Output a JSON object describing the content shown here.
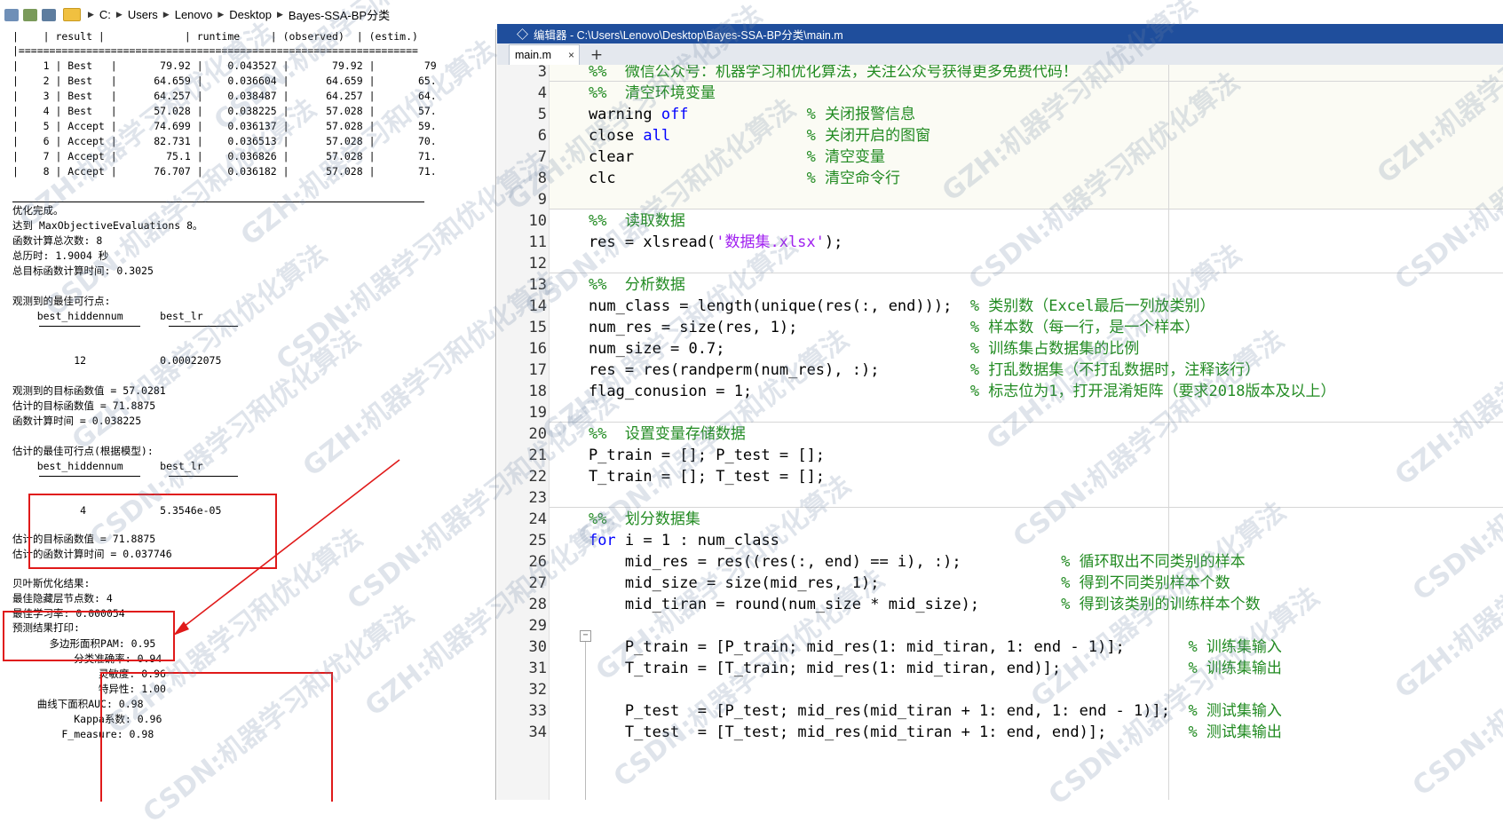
{
  "address_bar": {
    "crumbs": [
      "C:",
      "Users",
      "Lenovo",
      "Desktop",
      "Bayes-SSA-BP分类"
    ]
  },
  "command_window": {
    "table_header": "|    | result |             | runtime     | (observed)  | (estim.)",
    "table_rows": [
      "|    1 | Best   |       79.92 |    0.043527 |       79.92 |        79",
      "|    2 | Best   |      64.659 |    0.036604 |      64.659 |       65.",
      "|    3 | Best   |      64.257 |    0.038487 |      64.257 |       64.",
      "|    4 | Best   |      57.028 |    0.038225 |      57.028 |       57.",
      "|    5 | Accept |      74.699 |    0.036137 |      57.028 |       59.",
      "|    6 | Accept |      82.731 |    0.036513 |      57.028 |       70.",
      "|    7 | Accept |        75.1 |    0.036826 |      57.028 |       71.",
      "|    8 | Accept |      76.707 |    0.036182 |      57.028 |       71."
    ],
    "summary": [
      "优化完成。",
      "达到 MaxObjectiveEvaluations 8。",
      "函数计算总次数: 8",
      "总历时: 1.9004 秒",
      "总目标函数计算时间: 0.3025"
    ],
    "observed_title": "观测到的最佳可行点:",
    "observed_cols": "    best_hiddennum      best_lr",
    "observed_vals": "          12            0.00022075",
    "observed_stats": [
      "观测到的目标函数值 = 57.0281",
      "估计的目标函数值 = 71.8875",
      "函数计算时间 = 0.038225"
    ],
    "estimated_title": "估计的最佳可行点(根据模型):",
    "estimated_cols": "    best_hiddennum      best_lr",
    "estimated_vals": "           4            5.3546e-05",
    "estimated_stats": [
      "估计的目标函数值 = 71.8875",
      "估计的函数计算时间 = 0.037746"
    ],
    "bayes_result": [
      "贝叶斯优化结果:",
      "最佳隐藏层节点数: 4",
      "最佳学习率: 0.000054"
    ],
    "predict_title": "预测结果打印:",
    "predict_rows": [
      "      多边形面积PAM: 0.95",
      "          分类准确率: 0.94",
      "              灵敏度: 0.96",
      "              特异性: 1.00",
      "    曲线下面积AUC: 0.98",
      "          Kappa系数: 0.96",
      "        F_measure: 0.98"
    ]
  },
  "editor": {
    "title": "编辑器 - C:\\Users\\Lenovo\\Desktop\\Bayes-SSA-BP分类\\main.m",
    "tab_label": "main.m",
    "tab_close": "×",
    "tab_add": "+",
    "line_numbers": [
      "3",
      "4",
      "5",
      "6",
      "7",
      "8",
      "9",
      "10",
      "11",
      "12",
      "13",
      "14",
      "15",
      "16",
      "17",
      "18",
      "19",
      "20",
      "21",
      "22",
      "23",
      "24",
      "25",
      "26",
      "27",
      "28",
      "29",
      "30",
      "31",
      "32",
      "33",
      "34"
    ],
    "fold_marker": "−",
    "lines": [
      {
        "n": "3",
        "code": "    ",
        "cm": "%%  微信公众号：机器学习和优化算法，关注公众号获得更多免费代码！"
      },
      {
        "n": "4",
        "code": "    ",
        "cm": "%%  清空环境变量"
      },
      {
        "n": "5",
        "code": "    warning ",
        "kw": "off",
        "pad": "             ",
        "cm": "% 关闭报警信息"
      },
      {
        "n": "6",
        "code": "    close ",
        "kw": "all",
        "pad": "               ",
        "cm": "% 关闭开启的图窗"
      },
      {
        "n": "7",
        "code": "    clear                   ",
        "cm": "% 清空变量"
      },
      {
        "n": "8",
        "code": "    clc                     ",
        "cm": "% 清空命令行"
      },
      {
        "n": "10",
        "code": "    ",
        "cm": "%%  读取数据"
      },
      {
        "n": "11",
        "code": "    res = xlsread(",
        "str": "'数据集.xlsx'",
        "tail": ");"
      },
      {
        "n": "13",
        "code": "    ",
        "cm": "%%  分析数据"
      },
      {
        "n": "14",
        "code": "    num_class = length(unique(res(:, end)));  ",
        "cm": "% 类别数（Excel最后一列放类别）"
      },
      {
        "n": "15",
        "code": "    num_res = size(res, 1);                   ",
        "cm": "% 样本数（每一行，是一个样本）"
      },
      {
        "n": "16",
        "code": "    num_size = 0.7;                           ",
        "cm": "% 训练集占数据集的比例"
      },
      {
        "n": "17",
        "code": "    res = res(randperm(num_res), :);          ",
        "cm": "% 打乱数据集（不打乱数据时，注释该行）"
      },
      {
        "n": "18",
        "code": "    flag_conusion = 1;                        ",
        "cm": "% 标志位为1，打开混淆矩阵（要求2018版本及以上）"
      },
      {
        "n": "20",
        "code": "    ",
        "cm": "%%  设置变量存储数据"
      },
      {
        "n": "21",
        "code": "    P_train = []; P_test = [];"
      },
      {
        "n": "22",
        "code": "    T_train = []; T_test = [];"
      },
      {
        "n": "24",
        "code": "    ",
        "cm": "%%  划分数据集"
      },
      {
        "n": "25",
        "code": "    ",
        "kw": "for",
        "tail": " i = 1 : num_class"
      },
      {
        "n": "26",
        "code": "        mid_res = res((res(:, end) == i), :);           ",
        "cm": "% 循环取出不同类别的样本"
      },
      {
        "n": "27",
        "code": "        mid_size = size(mid_res, 1);                    ",
        "cm": "% 得到不同类别样本个数"
      },
      {
        "n": "28",
        "code": "        mid_tiran = round(num_size * mid_size);         ",
        "cm": "% 得到该类别的训练样本个数"
      },
      {
        "n": "30",
        "code": "        P_train = [P_train; mid_res(1: mid_tiran, 1: end - 1)];       ",
        "cm": "% 训练集输入"
      },
      {
        "n": "31",
        "code": "        T_train = [T_train; mid_res(1: mid_tiran, end)];              ",
        "cm": "% 训练集输出"
      },
      {
        "n": "33",
        "code": "        P_test  = [P_test; mid_res(mid_tiran + 1: end, 1: end - 1)];  ",
        "cm": "% 测试集输入"
      },
      {
        "n": "34",
        "code": "        T_test  = [T_test; mid_res(mid_tiran + 1: end, end)];         ",
        "cm": "% 测试集输出"
      }
    ]
  },
  "watermarks": [
    "GZH:机器学习和优化算法",
    "CSDN:机器学习和优化算法"
  ],
  "colors": {
    "keyword": "#0000ff",
    "string": "#a020f0",
    "comment": "#228b22",
    "title_bar": "#1f4e9c",
    "annotation": "#e01a1a"
  }
}
